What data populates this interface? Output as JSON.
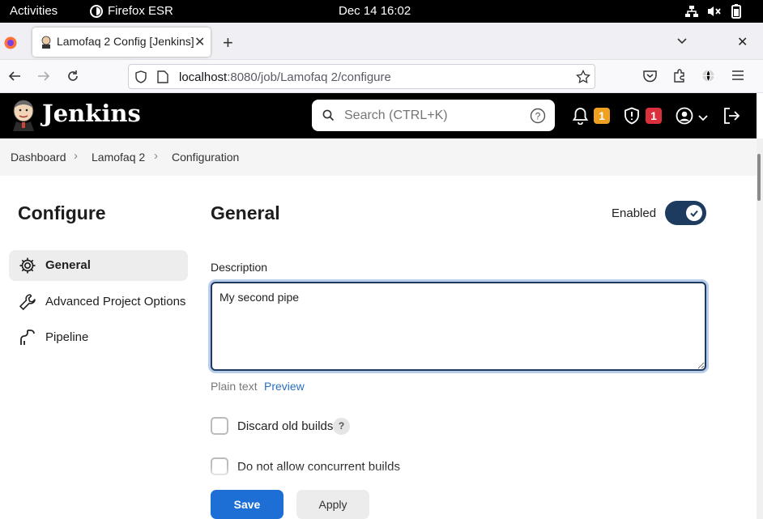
{
  "system": {
    "activities": "Activities",
    "app_name": "Firefox ESR",
    "clock": "Dec 14  16:02"
  },
  "browser": {
    "tab_title": "Lamofaq 2 Config [Jenkins]",
    "url_host": "localhost",
    "url_rest": ":8080/job/Lamofaq 2/configure"
  },
  "jenkins": {
    "brand": "Jenkins",
    "search_placeholder": "Search (CTRL+K)",
    "notifications_count": "1",
    "security_count": "1"
  },
  "breadcrumb": [
    "Dashboard",
    "Lamofaq 2",
    "Configuration"
  ],
  "sidebar": {
    "heading": "Configure",
    "items": [
      {
        "label": "General",
        "icon": "gear-icon",
        "active": true
      },
      {
        "label": "Advanced Project Options",
        "icon": "wrench-icon",
        "active": false
      },
      {
        "label": "Pipeline",
        "icon": "pipeline-icon",
        "active": false
      }
    ]
  },
  "general": {
    "heading": "General",
    "enabled_label": "Enabled",
    "enabled": true,
    "description_label": "Description",
    "description_value": "My second pipe",
    "plain_text": "Plain text",
    "preview": "Preview",
    "options": [
      {
        "label": "Discard old builds",
        "checked": false,
        "help": "?"
      },
      {
        "label": "Do not allow concurrent builds",
        "checked": false
      }
    ]
  },
  "actions": {
    "save": "Save",
    "apply": "Apply"
  },
  "colors": {
    "header_bg": "#000000",
    "toggle_on": "#1d3a5f",
    "save_button": "#1d6fd6",
    "notification_badge": "#f0a020",
    "security_badge": "#d9303b"
  }
}
